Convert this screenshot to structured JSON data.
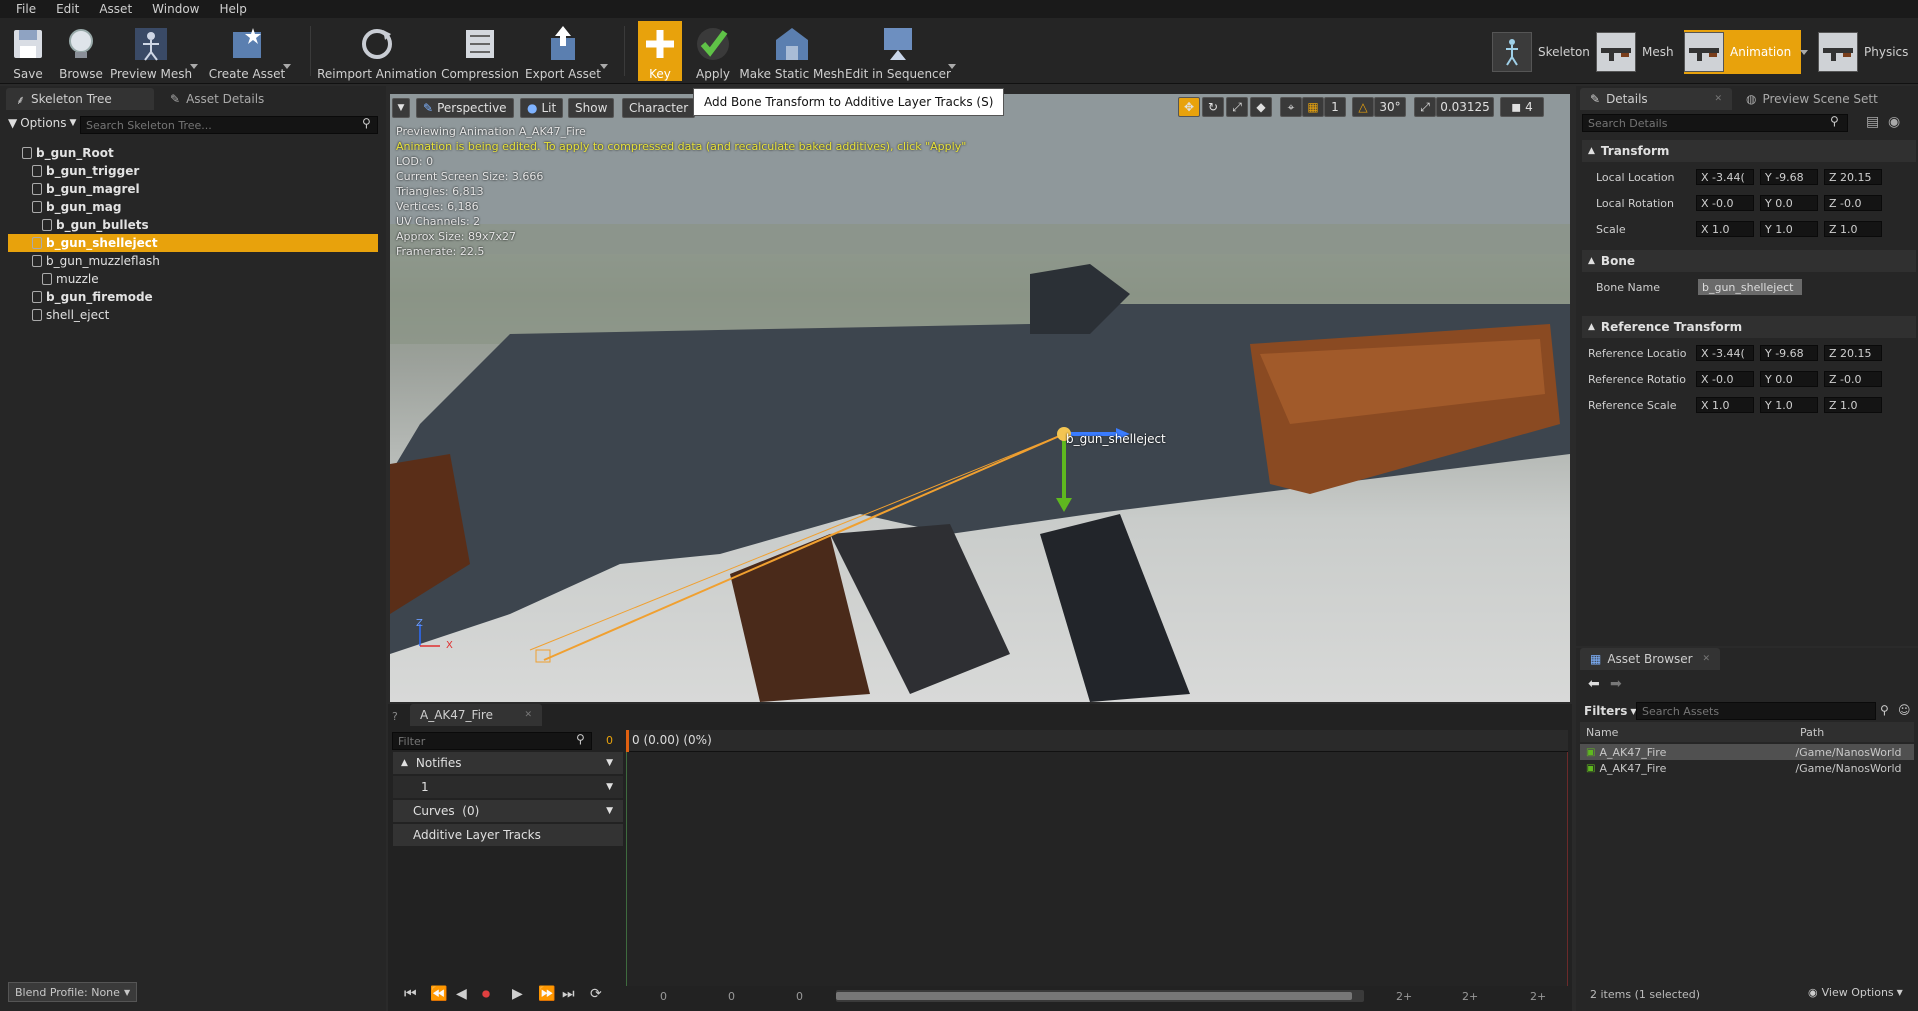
{
  "menu": [
    "File",
    "Edit",
    "Asset",
    "Window",
    "Help"
  ],
  "toolbar": {
    "save": "Save",
    "browse": "Browse",
    "preview_mesh": "Preview Mesh",
    "create_asset": "Create Asset",
    "reimport": "Reimport Animation",
    "compression": "Compression",
    "export_asset": "Export Asset",
    "key": "Key",
    "apply": "Apply",
    "make_static_mesh": "Make Static Mesh",
    "edit_in_sequencer": "Edit in Sequencer",
    "tooltip": "Add Bone Transform to Additive Layer Tracks (S)"
  },
  "modes": {
    "skeleton": "Skeleton",
    "mesh": "Mesh",
    "animation": "Animation",
    "physics": "Physics"
  },
  "left": {
    "tabs": [
      "Skeleton Tree",
      "Asset Details"
    ],
    "options": "Options",
    "search_placeholder": "Search Skeleton Tree...",
    "tree": [
      {
        "label": "b_gun_Root",
        "bold": true,
        "indent": 0,
        "selected": false
      },
      {
        "label": "b_gun_trigger",
        "bold": true,
        "indent": 1,
        "selected": false
      },
      {
        "label": "b_gun_magrel",
        "bold": true,
        "indent": 1,
        "selected": false
      },
      {
        "label": "b_gun_mag",
        "bold": true,
        "indent": 1,
        "selected": false
      },
      {
        "label": "b_gun_bullets",
        "bold": true,
        "indent": 2,
        "selected": false
      },
      {
        "label": "b_gun_shelleject",
        "bold": true,
        "indent": 1,
        "selected": true
      },
      {
        "label": "b_gun_muzzleflash",
        "bold": false,
        "indent": 1,
        "selected": false
      },
      {
        "label": "muzzle",
        "bold": false,
        "indent": 2,
        "selected": false
      },
      {
        "label": "b_gun_firemode",
        "bold": true,
        "indent": 1,
        "selected": false
      },
      {
        "label": "shell_eject",
        "bold": false,
        "indent": 1,
        "selected": false
      }
    ],
    "blend_profile": "Blend Profile: None"
  },
  "viewport": {
    "perspective": "Perspective",
    "lit": "Lit",
    "show": "Show",
    "character": "Character",
    "angle": "30°",
    "speed": "0.03125",
    "cam": "4",
    "grid": "1",
    "info": [
      "Previewing Animation A_AK47_Fire",
      "Animation is being edited. To apply to compressed data (and recalculate baked additives), click \"Apply\"",
      "LOD: 0",
      "Current Screen Size: 3.666",
      "Triangles: 6,813",
      "Vertices: 6,186",
      "UV Channels: 2",
      "Approx Size: 89x7x27",
      "Framerate: 22.5"
    ],
    "bone_label": "b_gun_shelleject",
    "axis_z": "Z",
    "axis_x": "X"
  },
  "details": {
    "tabs": [
      "Details",
      "Preview Scene Sett"
    ],
    "search_placeholder": "Search Details",
    "transform": "Transform",
    "rows": [
      {
        "label": "Local Location",
        "x": "X -3.44(",
        "y": "Y -9.68",
        "z": "Z 20.15"
      },
      {
        "label": "Local Rotation",
        "x": "X -0.0",
        "y": "Y 0.0",
        "z": "Z -0.0"
      },
      {
        "label": "Scale",
        "x": "X 1.0",
        "y": "Y 1.0",
        "z": "Z 1.0"
      }
    ],
    "bone": "Bone",
    "bone_name_label": "Bone Name",
    "bone_name": "b_gun_shelleject",
    "reference_transform": "Reference Transform",
    "ref_rows": [
      {
        "label": "Reference Locatio",
        "x": "X -3.44(",
        "y": "Y -9.68",
        "z": "Z 20.15"
      },
      {
        "label": "Reference Rotatio",
        "x": "X -0.0",
        "y": "Y 0.0",
        "z": "Z -0.0"
      },
      {
        "label": "Reference Scale",
        "x": "X 1.0",
        "y": "Y 1.0",
        "z": "Z 1.0"
      }
    ]
  },
  "asset_browser": {
    "tab": "Asset Browser",
    "filters": "Filters",
    "search_placeholder": "Search Assets",
    "col_name": "Name",
    "col_path": "Path",
    "items": [
      {
        "name": "A_AK47_Fire",
        "path": "/Game/NanosWorld"
      },
      {
        "name": "A_AK47_Fire",
        "path": "/Game/NanosWorld"
      }
    ],
    "status": "2 items (1 selected)",
    "view_options": "View Options"
  },
  "timeline": {
    "tab": "A_AK47_Fire",
    "filter_placeholder": "Filter",
    "frame": "0",
    "scrub": "0 (0.00) (0%)",
    "notifies": "Notifies",
    "track": "1",
    "curves": "Curves  (0)",
    "additive": "Additive Layer Tracks",
    "ticks": [
      "0",
      "0",
      "0",
      "2+",
      "2+",
      "2+"
    ]
  },
  "colors": {
    "accent": "#e8a20c",
    "bg": "#262626",
    "dark": "#141414"
  }
}
